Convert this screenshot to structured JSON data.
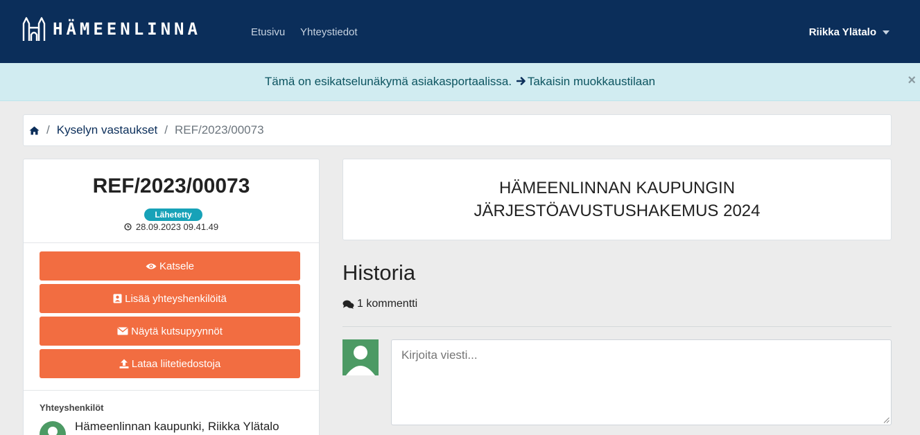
{
  "navbar": {
    "brand_text": "HÄMEENLINNA",
    "links": [
      "Etusivu",
      "Yhteystiedot"
    ],
    "user_name": "Riikka Ylätalo"
  },
  "alert": {
    "text": "Tämä on esikatselunäkymä asiakasportaalissa.",
    "link_text": "Takaisin muokkaustilaan",
    "close": "×"
  },
  "breadcrumb": {
    "sep": "/",
    "items": [
      "Kyselyn vastaukset",
      "REF/2023/00073"
    ]
  },
  "left_card": {
    "reference": "REF/2023/00073",
    "status_badge": "Lähetetty",
    "date": "28.09.2023 09.41.49",
    "buttons": [
      "Katsele",
      "Lisää yhteyshenkilöitä",
      "Näytä kutsupyynnöt",
      "Lataa liitetiedostoja"
    ],
    "contacts_title": "Yhteyshenkilöt",
    "contact_name": "Hämeenlinnan kaupunki, Riikka Ylätalo"
  },
  "main": {
    "title_line1": "HÄMEENLINNAN KAUPUNGIN",
    "title_line2": "JÄRJESTÖAVUSTUSHAKEMUS 2024",
    "history_heading": "Historia",
    "comments_count": "1 kommentti",
    "message_placeholder": "Kirjoita viesti..."
  },
  "colors": {
    "navbar": "#0b2e5a",
    "alert_bg": "#d1ecf1",
    "accent_button": "#f26d41",
    "badge": "#17a2b8",
    "avatar": "#4c9a64"
  },
  "icons": [
    "castle-logo-icon",
    "caret-down-icon",
    "arrow-right-icon",
    "close-icon",
    "home-icon",
    "clock-icon",
    "eye-icon",
    "contact-card-icon",
    "envelope-icon",
    "upload-icon",
    "comments-icon",
    "user-silhouette-icon"
  ]
}
